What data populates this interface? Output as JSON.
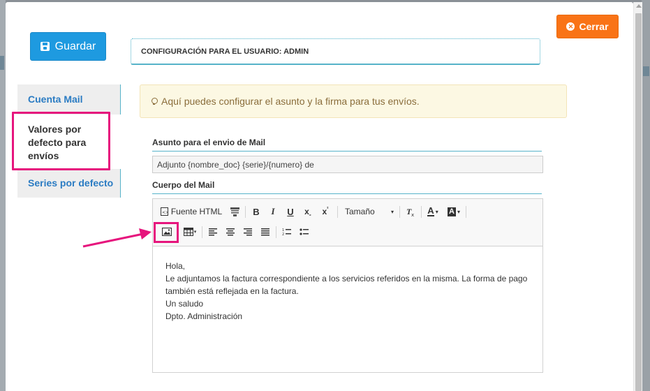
{
  "header": {
    "save_label": "Guardar",
    "close_label": "Cerrar",
    "user_config_title": "CONFIGURACIÓN PARA EL USUARIO: ADMIN"
  },
  "tabs": [
    {
      "label": "Cuenta Mail"
    },
    {
      "label": "Valores por defecto para envíos",
      "active": true
    },
    {
      "label": "Series por defecto"
    }
  ],
  "alert": {
    "text": "Aquí puedes configurar el asunto y la firma para tus envíos."
  },
  "form": {
    "subject_label": "Asunto para el envio de Mail",
    "subject_value": "Adjunto {nombre_doc} {serie}/{numero} de",
    "body_label": "Cuerpo del Mail"
  },
  "toolbar": {
    "source_label": "Fuente HTML",
    "size_label": "Tamaño",
    "bold": "B",
    "italic": "I",
    "underline": "U",
    "subscript": "x",
    "superscript": "x",
    "text_color": "A",
    "bg_color": "A"
  },
  "body_lines": [
    "Hola,",
    "Le adjuntamos la factura correspondiente a los servicios referidos en la misma. La forma de pago también está reflejada en la factura.",
    "Un saludo",
    "Dpto. Administración"
  ],
  "colors": {
    "accent_blue": "#1e9ae0",
    "close_orange": "#f97316",
    "highlight_pink": "#e6157d",
    "divider_teal": "#56b3c9",
    "alert_bg": "#fcf8e3"
  }
}
